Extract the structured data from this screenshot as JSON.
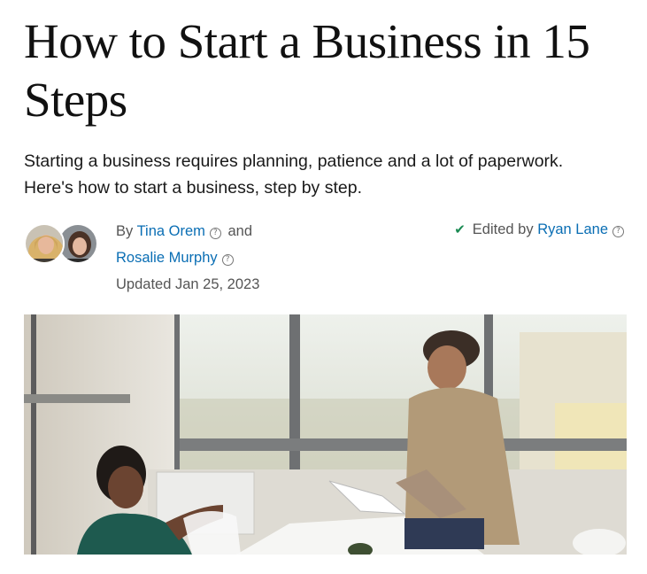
{
  "article": {
    "title": "How to Start a Business in 15 Steps",
    "subtitle": "Starting a business requires planning, patience and a lot of paperwork. Here's how to start a business, step by step."
  },
  "byline": {
    "by": "By",
    "author1": "Tina Orem",
    "and": "and",
    "author2": "Rosalie Murphy",
    "updated": "Updated Jan 25, 2023",
    "edited_by": "Edited by",
    "editor": "Ryan Lane",
    "help_glyph": "?"
  },
  "icons": {
    "check": "checkmark-icon",
    "help": "question-circle-icon"
  },
  "colors": {
    "link": "#0a6eb4",
    "check": "#1b8a53"
  }
}
